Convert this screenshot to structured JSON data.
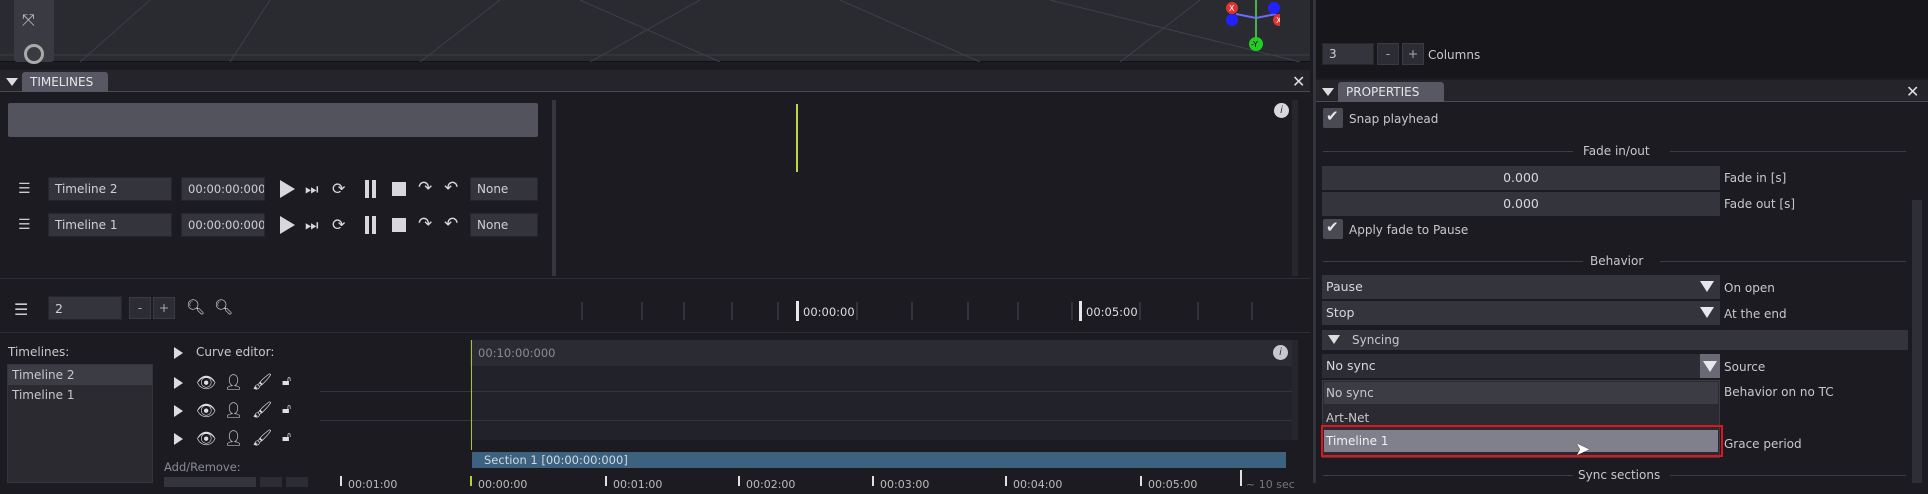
{
  "viewport": {
    "gizmo": {
      "x_label": "X",
      "y_label": "-Y"
    }
  },
  "timelines_panel": {
    "title": "TIMELINES",
    "rows": [
      {
        "name": "Timeline 2",
        "time": "00:00:00:000",
        "mode": "None",
        "ruler_time": "00:00:00:000",
        "section": "Section 1",
        "section_time": "-00:10:00:000",
        "section_color": "#44718f"
      },
      {
        "name": "Timeline 1",
        "time": "00:00:00:000",
        "mode": "None",
        "ruler_time": "00:00:00:000",
        "section": "Section 1",
        "section_time": "-00:10:00:000",
        "section_color": "#5a9e72"
      }
    ],
    "bottom": {
      "count": "2",
      "minus": "-",
      "plus": "+"
    },
    "ruler": {
      "t0": "00:00:00",
      "t1": "00:05:00"
    }
  },
  "lower": {
    "timelines_label": "Timelines:",
    "list": [
      "Timeline 2",
      "Timeline 1"
    ],
    "curve_editor": "Curve editor:",
    "curve_time": "00:10:00:000",
    "add_remove": "Add/Remove:",
    "section_bar": "Section 1 [00:00:00:000]",
    "ticks": [
      "00:01:00",
      "00:00:00",
      "00:01:00",
      "00:02:00",
      "00:03:00",
      "00:04:00",
      "00:05:00"
    ],
    "zoom": "~ 10 sec"
  },
  "columns": {
    "value": "3",
    "minus": "-",
    "plus": "+",
    "label": "Columns"
  },
  "properties": {
    "title": "PROPERTIES",
    "snap_playhead": "Snap playhead",
    "fade_header": "Fade in/out",
    "fade_in_value": "0.000",
    "fade_in_label": "Fade in [s]",
    "fade_out_value": "0.000",
    "fade_out_label": "Fade out [s]",
    "apply_fade": "Apply fade to Pause",
    "behavior_header": "Behavior",
    "on_open_value": "Pause",
    "on_open_label": "On open",
    "at_end_value": "Stop",
    "at_end_label": "At the end",
    "syncing_header": "Syncing",
    "source_value": "No sync",
    "source_label": "Source",
    "behavior_no_tc_label": "Behavior on no TC",
    "grace_label": "Grace period",
    "sync_sections": "Sync sections",
    "dropdown_options": [
      "No sync",
      "Art-Net",
      "Timeline 1"
    ]
  }
}
